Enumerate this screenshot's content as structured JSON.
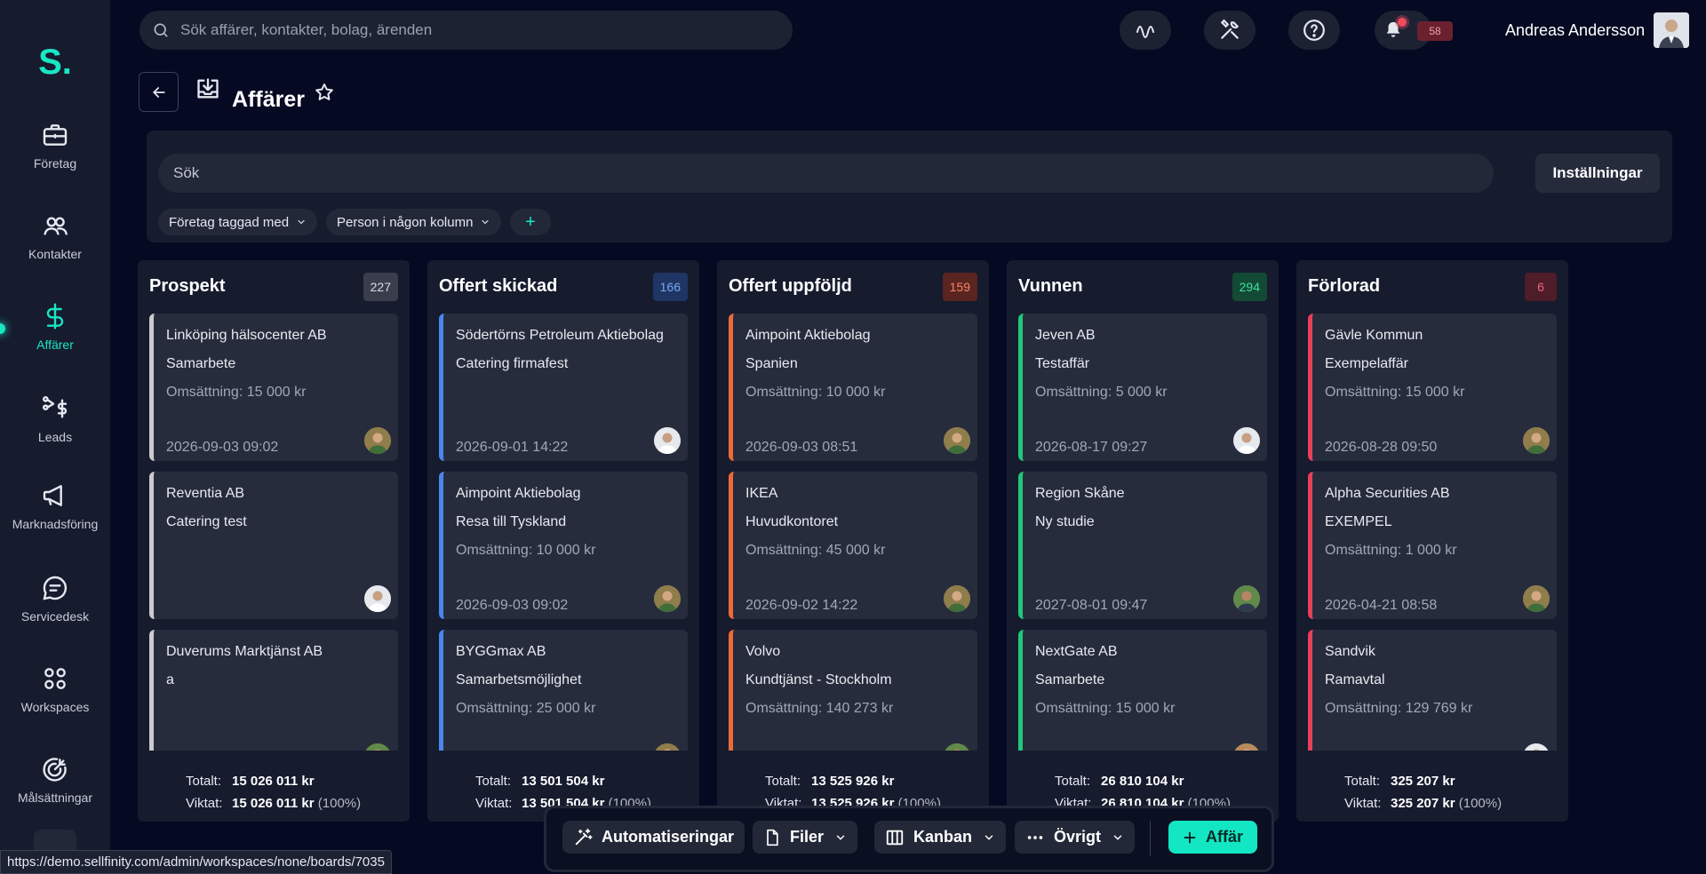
{
  "sidebar": {
    "logo": "S.",
    "items": [
      {
        "label": "Företag"
      },
      {
        "label": "Kontakter"
      },
      {
        "label": "Affärer"
      },
      {
        "label": "Leads"
      },
      {
        "label": "Marknadsföring"
      },
      {
        "label": "Servicedesk"
      },
      {
        "label": "Workspaces"
      },
      {
        "label": "Målsättningar"
      }
    ]
  },
  "topbar": {
    "search_placeholder": "Sök affärer, kontakter, bolag, ärenden",
    "notification_count": "58",
    "user_name": "Andreas Andersson"
  },
  "header": {
    "title": "Affärer"
  },
  "filters": {
    "search_placeholder": "Sök",
    "settings_label": "Inställningar",
    "chips": [
      "Företag taggad med",
      "Person i någon kolumn"
    ],
    "add_label": "+"
  },
  "columns": [
    {
      "title": "Prospekt",
      "count": "227",
      "color": "#cccccc",
      "count_bg": "#3a3e4c",
      "count_fg": "#d8dae2",
      "cards": [
        {
          "company": "Linköping hälsocenter AB",
          "deal": "Samarbete",
          "value": "Omsättning: 15 000 kr",
          "date": "2026-09-03 09:02",
          "avatar": "photo-a"
        },
        {
          "company": "Reventia AB",
          "deal": "Catering test",
          "value": "",
          "date": "",
          "avatar": "photo-b"
        },
        {
          "company": "Duverums Marktjänst AB",
          "deal": "a",
          "value": "",
          "date": "",
          "avatar": "photo-c"
        }
      ],
      "totals": {
        "total_label": "Totalt:",
        "total": "15 026 011 kr",
        "weighted_label": "Viktat:",
        "weighted": "15 026 011 kr",
        "pct": "(100%)"
      }
    },
    {
      "title": "Offert skickad",
      "count": "166",
      "color": "#4b86ee",
      "count_bg": "#1f3563",
      "count_fg": "#7aa8f5",
      "cards": [
        {
          "company": "Södertörns Petroleum Aktiebolag",
          "deal": "Catering firmafest",
          "value": "",
          "date": "2026-09-01 14:22",
          "avatar": "photo-b"
        },
        {
          "company": "Aimpoint Aktiebolag",
          "deal": "Resa till Tyskland",
          "value": "Omsättning: 10 000 kr",
          "date": "2026-09-03 09:02",
          "avatar": "photo-a"
        },
        {
          "company": "BYGGmax AB",
          "deal": "Samarbetsmöjlighet",
          "value": "Omsättning: 25 000 kr",
          "date": "",
          "avatar": "photo-a"
        }
      ],
      "totals": {
        "total_label": "Totalt:",
        "total": "13 501 504 kr",
        "weighted_label": "Viktat:",
        "weighted": "13 501 504 kr",
        "pct": "(100%)"
      }
    },
    {
      "title": "Offert uppföljd",
      "count": "159",
      "color": "#ee6a36",
      "count_bg": "#5a2420",
      "count_fg": "#f5856a",
      "cards": [
        {
          "company": "Aimpoint Aktiebolag",
          "deal": "Spanien",
          "value": "Omsättning: 10 000 kr",
          "date": "2026-09-03 08:51",
          "avatar": "photo-a"
        },
        {
          "company": "IKEA",
          "deal": "Huvudkontoret",
          "value": "Omsättning: 45 000 kr",
          "date": "2026-09-02 14:22",
          "avatar": "photo-a"
        },
        {
          "company": "Volvo",
          "deal": "Kundtjänst - Stockholm",
          "value": "Omsättning: 140 273 kr",
          "date": "",
          "avatar": "photo-c"
        }
      ],
      "totals": {
        "total_label": "Totalt:",
        "total": "13 525 926 kr",
        "weighted_label": "Viktat:",
        "weighted": "13 525 926 kr",
        "pct": "(100%)"
      }
    },
    {
      "title": "Vunnen",
      "count": "294",
      "color": "#1fc87a",
      "count_bg": "#134a35",
      "count_fg": "#3fe09a",
      "cards": [
        {
          "company": "Jeven AB",
          "deal": "Testaffär",
          "value": "Omsättning: 5 000 kr",
          "date": "2026-08-17 09:27",
          "avatar": "photo-b"
        },
        {
          "company": "Region Skåne",
          "deal": "Ny studie",
          "value": "",
          "date": "2027-08-01 09:47",
          "avatar": "photo-c"
        },
        {
          "company": "NextGate AB",
          "deal": "Samarbete",
          "value": "Omsättning: 15 000 kr",
          "date": "",
          "avatar": "photo-d"
        }
      ],
      "totals": {
        "total_label": "Totalt:",
        "total": "26 810 104 kr",
        "weighted_label": "Viktat:",
        "weighted": "26 810 104 kr",
        "pct": "(100%)"
      }
    },
    {
      "title": "Förlorad",
      "count": "6",
      "color": "#e8405a",
      "count_bg": "#4f1c2a",
      "count_fg": "#f0657a",
      "cards": [
        {
          "company": "Gävle Kommun",
          "deal": "Exempelaffär",
          "value": "Omsättning: 15 000 kr",
          "date": "2026-08-28 09:50",
          "avatar": "photo-a"
        },
        {
          "company": "Alpha Securities AB",
          "deal": "EXEMPEL",
          "value": "Omsättning: 1 000 kr",
          "date": "2026-04-21 08:58",
          "avatar": "photo-a"
        },
        {
          "company": "Sandvik",
          "deal": "Ramavtal",
          "value": "Omsättning: 129 769 kr",
          "date": "",
          "avatar": "photo-b"
        }
      ],
      "totals": {
        "total_label": "Totalt:",
        "total": "325 207 kr",
        "weighted_label": "Viktat:",
        "weighted": "325 207 kr",
        "pct": "(100%)"
      }
    }
  ],
  "toolbar": {
    "automations_label": "Automatiseringar",
    "files_label": "Filer",
    "view_label": "Kanban",
    "other_label": "Övrigt",
    "add_label": "Affär"
  },
  "status_bar": {
    "url": "https://demo.sellfinity.com/admin/workspaces/none/boards/7035"
  },
  "colors": {
    "accent": "#19e6c3",
    "background": "#050922",
    "panel": "#161b2e",
    "card": "#272c3d"
  }
}
